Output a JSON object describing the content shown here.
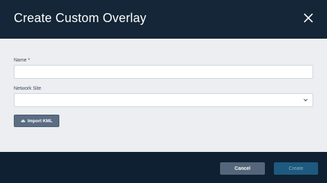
{
  "dialog": {
    "title": "Create Custom Overlay",
    "close_icon": "close-icon"
  },
  "form": {
    "name_label": "Name *",
    "name_value": "",
    "network_site_label": "Network Site",
    "network_site_value": "",
    "import_kml_label": "Import KML",
    "import_kml_icon": "upload-cloud-icon"
  },
  "footer": {
    "cancel_label": "Cancel",
    "create_label": "Create"
  },
  "colors": {
    "header_bg": "#142637",
    "body_bg": "#eceef1",
    "footer_bg": "#0f2033",
    "cancel_bg": "#55657a",
    "create_bg": "#1d5a7e",
    "import_bg": "#5b6d83"
  }
}
